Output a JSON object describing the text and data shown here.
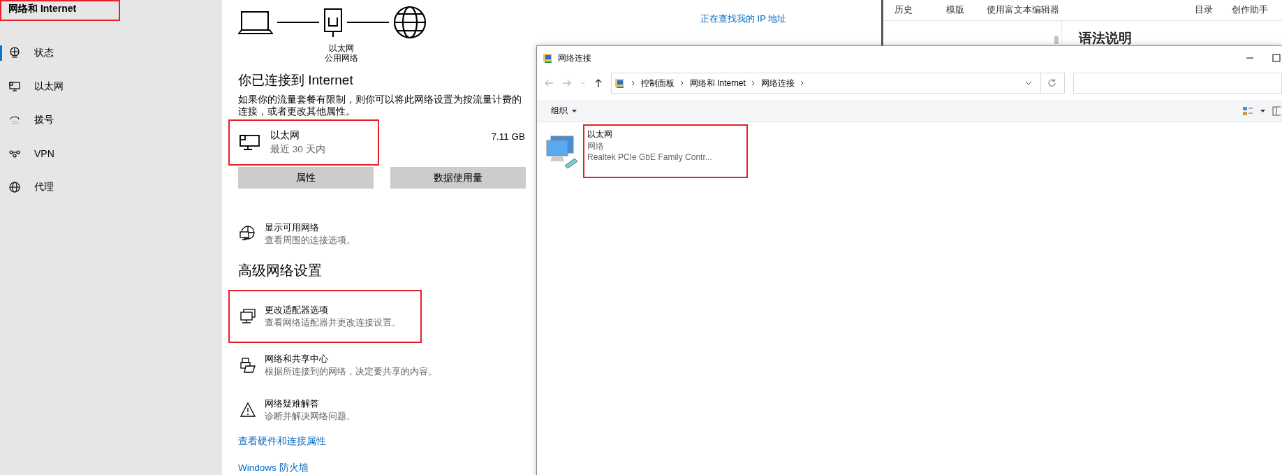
{
  "settings": {
    "sidebar": {
      "title": "网络和 Internet",
      "title_highlighted": true,
      "items": [
        {
          "kind": "status",
          "label": "状态",
          "selected": true
        },
        {
          "kind": "ethernet",
          "label": "以太网",
          "selected": false
        },
        {
          "kind": "dialup",
          "label": "拨号",
          "selected": false
        },
        {
          "kind": "vpn",
          "label": "VPN",
          "selected": false
        },
        {
          "kind": "proxy",
          "label": "代理",
          "selected": false
        }
      ]
    },
    "status": {
      "diagram": {
        "device_label": "以太网",
        "network_label": "公用网络"
      },
      "ip_link": "正在查找我的 IP 地址",
      "heading": "你已连接到 Internet",
      "description": "如果你的流量套餐有限制，则你可以将此网络设置为按流量计费的连接，或者更改其他属性。",
      "connection": {
        "name": "以太网",
        "period": "最近 30 天内",
        "usage": "7.11 GB",
        "highlighted": true
      },
      "buttons": [
        "属性",
        "数据使用量"
      ],
      "options": [
        {
          "kind": "globe-monitor",
          "title": "显示可用网络",
          "subtitle": "查看周围的连接选项。",
          "highlighted": false
        }
      ],
      "advanced_heading": "高级网络设置",
      "advanced_options": [
        {
          "kind": "adapter",
          "title": "更改适配器选项",
          "subtitle": "查看网络适配器并更改连接设置。",
          "highlighted": true
        },
        {
          "kind": "sharing",
          "title": "网络和共享中心",
          "subtitle": "根据所连接到的网络，决定要共享的内容。",
          "highlighted": false
        },
        {
          "kind": "warning",
          "title": "网络疑难解答",
          "subtitle": "诊断并解决网络问题。",
          "highlighted": false
        }
      ],
      "links": [
        "查看硬件和连接属性",
        "Windows 防火墙"
      ]
    }
  },
  "editor": {
    "toolbar_left": [
      "历史",
      "模版",
      "使用富文本编辑器"
    ],
    "toolbar_right": [
      "目录",
      "创作助手"
    ],
    "heading": "语法说明"
  },
  "explorer": {
    "title": "网络连接",
    "breadcrumb": [
      "控制面板",
      "网络和 Internet",
      "网络连接"
    ],
    "command": "组织",
    "items": [
      {
        "name": "以太网",
        "status": "网络",
        "device": "Realtek PCIe GbE Family Contr...",
        "highlighted": true
      }
    ]
  }
}
